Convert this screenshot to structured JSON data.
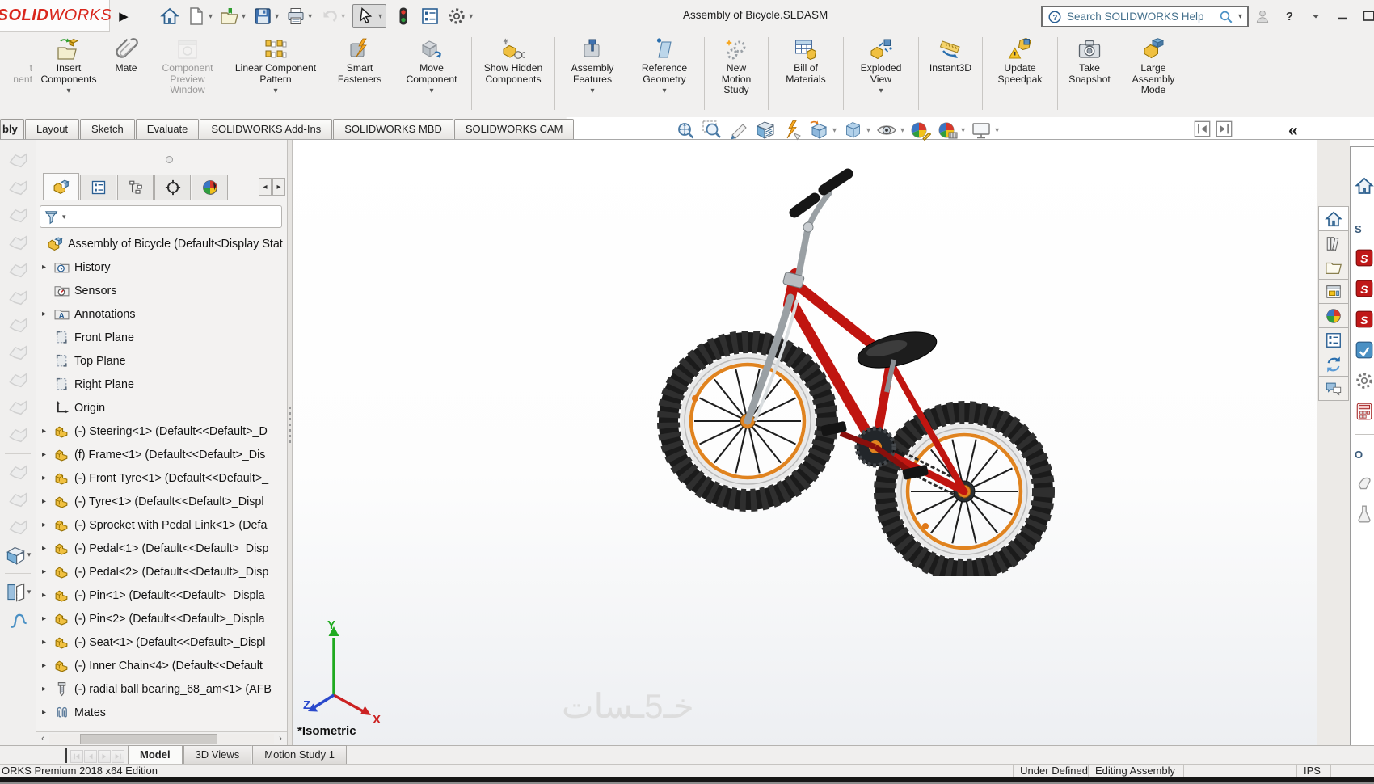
{
  "colors": {
    "brand_red": "#d9261c",
    "frame_red": "#c01510",
    "rim_orange": "#e0831f",
    "accent_blue": "#2a6fae",
    "taskpane_red": "#c01818"
  },
  "titlebar": {
    "brand_bold": "SOLID",
    "brand_light": "WORKS",
    "document_title": "Assembly of Bicycle.SLDASM",
    "search_placeholder": "Search SOLIDWORKS Help",
    "quick_tools": [
      {
        "icon": "home"
      },
      {
        "icon": "new-doc",
        "dropdown": true
      },
      {
        "icon": "open",
        "dropdown": true
      },
      {
        "icon": "save",
        "dropdown": true
      },
      {
        "icon": "print",
        "dropdown": true
      },
      {
        "icon": "undo",
        "dropdown": true,
        "disabled": true
      },
      {
        "icon": "select-cursor",
        "dropdown": true,
        "boxed": true
      },
      {
        "icon": "traffic-light"
      },
      {
        "icon": "properties-list"
      },
      {
        "icon": "settings-gear",
        "dropdown": true
      }
    ],
    "window_controls": [
      {
        "icon": "user"
      },
      {
        "icon": "help-question"
      },
      {
        "icon": "chevron-down"
      },
      {
        "icon": "minimize"
      },
      {
        "icon": "maximize"
      }
    ]
  },
  "ribbon": {
    "buttons": [
      {
        "label": "t\nnent",
        "icon": "edit-component",
        "disabled": true,
        "partial": true
      },
      {
        "label": "Insert Components",
        "icon": "insert-components",
        "dropdown": true,
        "w": "w74"
      },
      {
        "label": "Mate",
        "icon": "mate"
      },
      {
        "label": "Component Preview Window",
        "icon": "component-preview",
        "disabled": true,
        "w": "w90"
      },
      {
        "label": "Linear Component Pattern",
        "icon": "linear-pattern",
        "dropdown": true,
        "w": "w110"
      },
      {
        "label": "Smart Fasteners",
        "icon": "smart-fasteners",
        "w": "w74"
      },
      {
        "label": "Move Component",
        "icon": "move-component",
        "dropdown": true,
        "w": "w80"
      },
      {
        "sep": true
      },
      {
        "label": "Show Hidden Components",
        "icon": "show-hidden-components",
        "w": "w90"
      },
      {
        "sep": true
      },
      {
        "label": "Assembly Features",
        "icon": "assembly-features",
        "dropdown": true,
        "w": "w74"
      },
      {
        "label": "Reference Geometry",
        "icon": "reference-geometry",
        "dropdown": true,
        "w": "w80"
      },
      {
        "sep": true
      },
      {
        "label": "New Motion Study",
        "icon": "new-motion-study",
        "w": "w64"
      },
      {
        "sep": true
      },
      {
        "label": "Bill of Materials",
        "icon": "bill-of-materials",
        "w": "w74"
      },
      {
        "sep": true
      },
      {
        "label": "Exploded View",
        "icon": "exploded-view",
        "dropdown": true,
        "w": "w74"
      },
      {
        "sep": true
      },
      {
        "label": "Instant3D",
        "icon": "instant3d",
        "w": "w64"
      },
      {
        "sep": true
      },
      {
        "label": "Update Speedpak",
        "icon": "update-speedpak",
        "w": "w74"
      },
      {
        "sep": true
      },
      {
        "label": "Take Snapshot",
        "icon": "take-snapshot",
        "w": "w64"
      },
      {
        "label": "Large Assembly Mode",
        "icon": "large-assembly-mode",
        "w": "w74"
      }
    ]
  },
  "ribbon_tabs": {
    "items": [
      {
        "label": "bly",
        "active": true,
        "partial": true
      },
      {
        "label": "Layout"
      },
      {
        "label": "Sketch"
      },
      {
        "label": "Evaluate"
      },
      {
        "label": "SOLIDWORKS Add-Ins"
      },
      {
        "label": "SOLIDWORKS MBD"
      },
      {
        "label": "SOLIDWORKS CAM"
      }
    ]
  },
  "headsup": {
    "items": [
      {
        "icon": "zoom-fit"
      },
      {
        "icon": "zoom-area"
      },
      {
        "icon": "previous-view"
      },
      {
        "icon": "section-view"
      },
      {
        "icon": "dynamic-annotation-views"
      },
      {
        "icon": "view-orientation",
        "dropdown": true
      },
      {
        "icon": "display-style",
        "dropdown": true
      },
      {
        "icon": "hide-show-items",
        "dropdown": true
      },
      {
        "icon": "edit-appearance"
      },
      {
        "icon": "apply-scene",
        "dropdown": true
      },
      {
        "icon": "view-settings",
        "dropdown": true
      }
    ]
  },
  "pane_buttons": [
    {
      "icon": "pane-previous"
    },
    {
      "icon": "pane-next"
    }
  ],
  "feature_manager": {
    "tabs": [
      {
        "icon": "fm-assembly",
        "active": true
      },
      {
        "icon": "fm-properties"
      },
      {
        "icon": "fm-config"
      },
      {
        "icon": "fm-dimxpert"
      },
      {
        "icon": "fm-appearance"
      }
    ],
    "tree": [
      {
        "label": "Assembly of Bicycle  (Default<Display Stat",
        "icon": "assembly",
        "root": true
      },
      {
        "label": "History",
        "icon": "history",
        "expand": true
      },
      {
        "label": "Sensors",
        "icon": "sensors"
      },
      {
        "label": "Annotations",
        "icon": "annotations",
        "expand": true
      },
      {
        "label": "Front Plane",
        "icon": "plane"
      },
      {
        "label": "Top Plane",
        "icon": "plane"
      },
      {
        "label": "Right Plane",
        "icon": "plane"
      },
      {
        "label": "Origin",
        "icon": "origin"
      },
      {
        "label": "(-) Steering<1> (Default<<Default>_D",
        "icon": "component",
        "expand": true
      },
      {
        "label": "(f) Frame<1> (Default<<Default>_Dis",
        "icon": "component",
        "expand": true
      },
      {
        "label": "(-) Front Tyre<1> (Default<<Default>_",
        "icon": "component",
        "expand": true
      },
      {
        "label": "(-) Tyre<1> (Default<<Default>_Displ",
        "icon": "component",
        "expand": true
      },
      {
        "label": "(-) Sprocket with Pedal Link<1> (Defa",
        "icon": "component",
        "expand": true
      },
      {
        "label": "(-) Pedal<1> (Default<<Default>_Disp",
        "icon": "component",
        "expand": true
      },
      {
        "label": "(-) Pedal<2> (Default<<Default>_Disp",
        "icon": "component",
        "expand": true
      },
      {
        "label": "(-) Pin<1> (Default<<Default>_Displa",
        "icon": "component",
        "expand": true
      },
      {
        "label": "(-) Pin<2> (Default<<Default>_Displa",
        "icon": "component",
        "expand": true
      },
      {
        "label": "(-) Seat<1> (Default<<Default>_Displ",
        "icon": "component",
        "expand": true
      },
      {
        "label": "(-) Inner Chain<4> (Default<<Default",
        "icon": "component",
        "expand": true
      },
      {
        "label": "(-) radial ball bearing_68_am<1> (AFB",
        "icon": "bearing",
        "expand": true
      },
      {
        "label": "Mates",
        "icon": "mates",
        "expand": true
      }
    ]
  },
  "left_toolbar": {
    "items": [
      {
        "icon": "ghost-tool"
      },
      {
        "icon": "ghost-tool"
      },
      {
        "icon": "ghost-tool"
      },
      {
        "icon": "ghost-tool"
      },
      {
        "icon": "ghost-tool"
      },
      {
        "icon": "ghost-tool"
      },
      {
        "icon": "ghost-tool"
      },
      {
        "icon": "ghost-tool"
      },
      {
        "icon": "ghost-tool"
      },
      {
        "icon": "ghost-tool"
      },
      {
        "icon": "ghost-tool"
      },
      {
        "sep": true
      },
      {
        "icon": "ghost-tool"
      },
      {
        "icon": "ghost-tool"
      },
      {
        "icon": "ghost-tool"
      },
      {
        "icon": "cube-tool",
        "dropdown": true
      },
      {
        "sep": true
      },
      {
        "icon": "split-tool",
        "dropdown": true
      },
      {
        "icon": "curve-tool"
      }
    ]
  },
  "taskpane": {
    "tabs": [
      {
        "icon": "tp-home",
        "active": true
      },
      {
        "icon": "tp-design-library"
      },
      {
        "icon": "tp-file-explorer"
      },
      {
        "icon": "tp-view-palette"
      },
      {
        "icon": "tp-appearances"
      },
      {
        "icon": "tp-custom-properties"
      },
      {
        "icon": "tp-sync"
      },
      {
        "icon": "tp-forum"
      }
    ],
    "sliver": [
      {
        "icon": "tp-home"
      },
      {
        "sep": true
      },
      {
        "label": "S"
      },
      {
        "icon": "sw-cube"
      },
      {
        "icon": "sw-cube"
      },
      {
        "icon": "sw-cube"
      },
      {
        "icon": "blue-tool"
      },
      {
        "icon": "gear-tool"
      },
      {
        "icon": "calc-tool"
      },
      {
        "sep": true
      },
      {
        "label": "O"
      },
      {
        "icon": "hand-ghost"
      },
      {
        "icon": "flask-ghost"
      }
    ]
  },
  "viewport": {
    "view_label": "*Isometric",
    "watermark": "خـ5ـسات",
    "axes": {
      "x": "X",
      "y": "Y",
      "z": "Z"
    }
  },
  "bottom_bar": {
    "nav": [
      {
        "icon": "nav-first",
        "disabled": true
      },
      {
        "icon": "nav-prev",
        "disabled": true
      },
      {
        "icon": "nav-next",
        "disabled": true
      },
      {
        "icon": "nav-last",
        "disabled": true
      }
    ],
    "tabs": [
      {
        "label": "Model",
        "active": true
      },
      {
        "label": "3D Views"
      },
      {
        "label": "Motion Study 1"
      }
    ]
  },
  "statusbar": {
    "left": "ORKS Premium 2018 x64 Edition",
    "cells": [
      {
        "label": "Under Defined"
      },
      {
        "label": "Editing Assembly"
      },
      {
        "label": ""
      },
      {
        "label": "IPS"
      },
      {
        "label": ""
      }
    ]
  }
}
